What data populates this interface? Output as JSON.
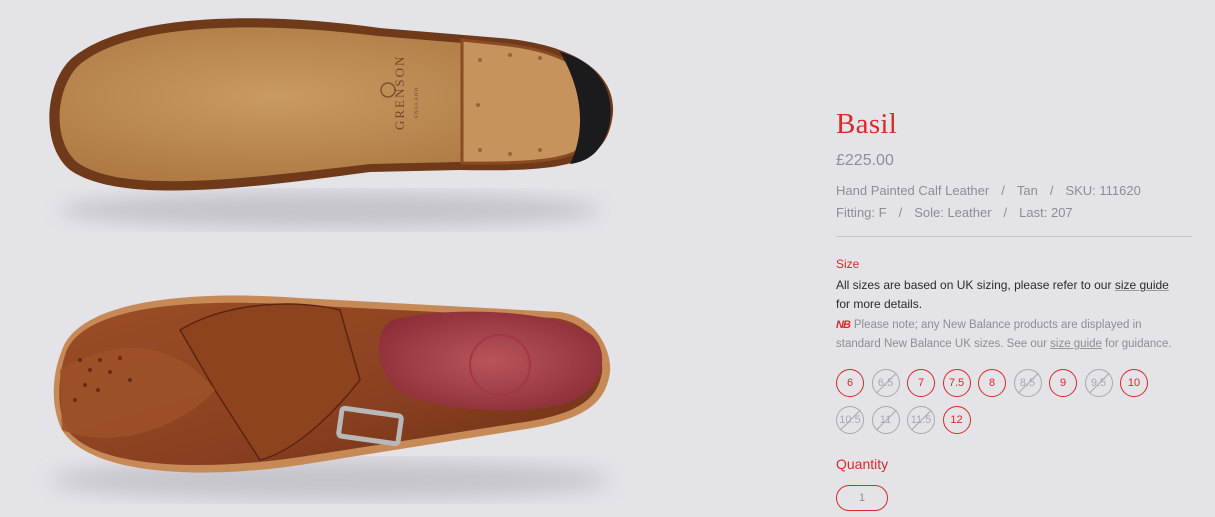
{
  "product": {
    "title": "Basil",
    "price": "£225.00",
    "material": "Hand Painted Calf Leather",
    "colour": "Tan",
    "sku": "SKU: 111620",
    "fitting": "Fitting: F",
    "sole": "Sole: Leather",
    "last": "Last: 207",
    "separator": "/",
    "sole_brand": "GRENSON",
    "sole_brand_sub": "ENGLAND"
  },
  "size_section": {
    "label": "Size",
    "note_before": "All sizes are based on UK sizing, please refer to our ",
    "note_link": "size guide",
    "note_after": " for more details.",
    "nb_logo": "NB",
    "nb_before": "Please note; any New Balance products are displayed in standard New Balance UK sizes. See our ",
    "nb_link": "size guide",
    "nb_after": " for guidance.",
    "sizes": [
      {
        "label": "6",
        "available": true
      },
      {
        "label": "6.5",
        "available": false
      },
      {
        "label": "7",
        "available": true
      },
      {
        "label": "7.5",
        "available": true
      },
      {
        "label": "8",
        "available": true
      },
      {
        "label": "8.5",
        "available": false
      },
      {
        "label": "9",
        "available": true
      },
      {
        "label": "9.5",
        "available": false
      },
      {
        "label": "10",
        "available": true
      },
      {
        "label": "10.5",
        "available": false
      },
      {
        "label": "11",
        "available": false
      },
      {
        "label": "11.5",
        "available": false
      },
      {
        "label": "12",
        "available": true
      }
    ]
  },
  "quantity": {
    "label": "Quantity",
    "value": "1"
  },
  "colors": {
    "accent": "#d62b27",
    "background": "#e4e3e8",
    "muted_text": "#8d8d93"
  }
}
